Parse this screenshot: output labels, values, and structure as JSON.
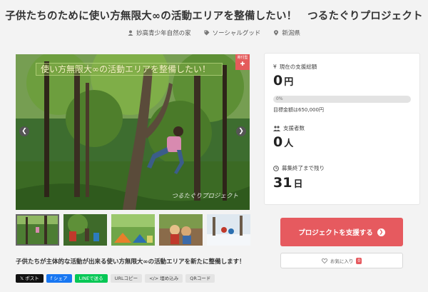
{
  "project": {
    "title": "子供たちのために使い方無限大∞の活動エリアを整備したい！　つるたぐりプロジェクト",
    "organizer": "妙高青少年自然の家",
    "category": "ソーシャルグッド",
    "location": "新潟県",
    "summary": "子供たちが主体的な活動が出来る使い方無限大∞の活動エリアを新たに整備します！"
  },
  "hero": {
    "banner_text": "使い方無限大∞の活動エリアを整備したい！",
    "corner_badge_top": "寄付型",
    "corner_badge_icon": "✚",
    "watermark": "つるたぐりプロジェクト",
    "prev_label": "❮",
    "next_label": "❯"
  },
  "stats": {
    "amount_label": "現在の支援総額",
    "amount_value": "0",
    "amount_unit": "円",
    "progress_percent": 0,
    "progress_label": "0%",
    "goal_text": "目標金額は650,000円",
    "supporters_label": "支援者数",
    "supporters_value": "0",
    "supporters_unit": "人",
    "remaining_label": "募集終了まで残り",
    "remaining_value": "31",
    "remaining_unit": "日"
  },
  "actions": {
    "support_button": "プロジェクトを支援する",
    "support_arrow": "❯",
    "favorite_label": "お気に入り",
    "favorite_count": "0"
  },
  "share": {
    "x_post": "𝕏 ポスト",
    "facebook": "f シェア",
    "line": "LINEで送る",
    "url_copy": "URLコピー",
    "embed": "</> 埋め込み",
    "qr": "QRコード"
  },
  "colors": {
    "accent": "#e65a5f",
    "background": "#f3f3f3"
  }
}
